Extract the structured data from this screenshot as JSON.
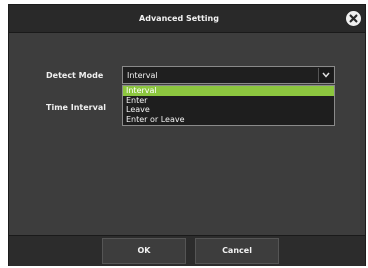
{
  "dialog": {
    "title": "Advanced Setting",
    "close_icon": "close-icon"
  },
  "fields": {
    "detect_mode_label": "Detect Mode",
    "time_interval_label": "Time Interval"
  },
  "detect_mode": {
    "selected_value": "Interval",
    "options": [
      "Interval",
      "Enter",
      "Leave",
      "Enter or Leave"
    ],
    "highlighted_option": "Interval",
    "highlight_color": "#8cc63f"
  },
  "footer": {
    "ok_label": "OK",
    "cancel_label": "Cancel"
  }
}
